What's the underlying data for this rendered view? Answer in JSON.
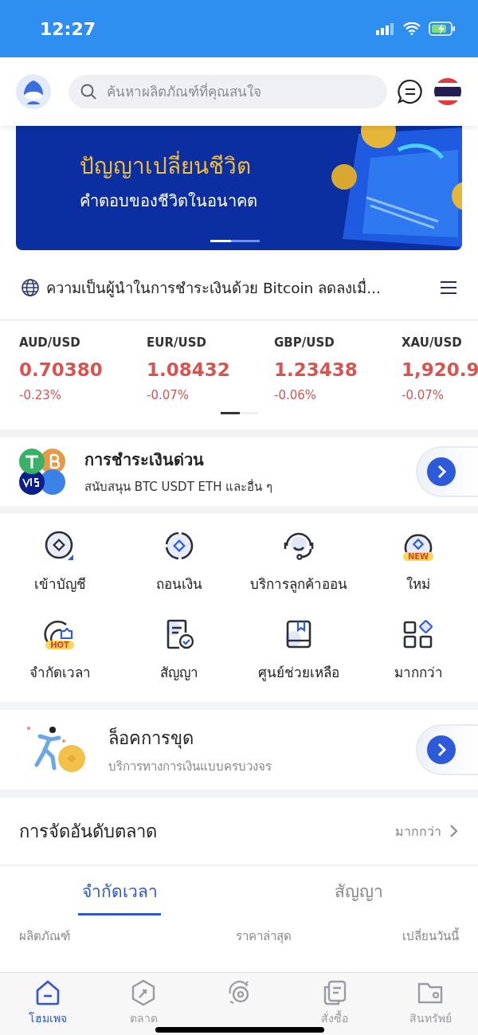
{
  "status_bar": {
    "time": "12:27"
  },
  "header": {
    "search": {
      "placeholder": "ค้นหาผลิตภัณฑ์ที่คุณสนใจ"
    }
  },
  "banner": {
    "title": "ปัญญาเปลี่ยนชีวิต",
    "subtitle": "คำตอบของชีวิตในอนาคต",
    "pages": [
      {
        "selected": true
      },
      {
        "selected": false
      }
    ]
  },
  "ticker": {
    "text": "ความเป็นผู้นำในการชำระเงินด้วย Bitcoin ลดลงเมื่..."
  },
  "quotes": [
    {
      "pair": "AUD/USD",
      "price": "0.70380",
      "change": "-0.23%"
    },
    {
      "pair": "EUR/USD",
      "price": "1.08432",
      "change": "-0.07%"
    },
    {
      "pair": "GBP/USD",
      "price": "1.23438",
      "change": "-0.06%"
    },
    {
      "pair": "XAU/USD",
      "price": "1,920.9",
      "change": "-0.07%"
    }
  ],
  "quote_pages": [
    {
      "selected": true
    },
    {
      "selected": false
    }
  ],
  "quick_pay": {
    "title": "การชำระเงินด่วน",
    "subtitle": "สนับสนุน BTC USDT ETH และอื่น ๆ"
  },
  "shortcuts": [
    {
      "kind": "deposit",
      "label": "เข้าบัญชี"
    },
    {
      "kind": "withdraw",
      "label": "ถอนเงิน"
    },
    {
      "kind": "support",
      "label": "บริการลูกค้าออน"
    },
    {
      "kind": "new",
      "label": "ใหม่",
      "badge": "NEW"
    },
    {
      "kind": "timer",
      "label": "จำกัดเวลา",
      "badge": "HOT"
    },
    {
      "kind": "contract",
      "label": "สัญญา"
    },
    {
      "kind": "help",
      "label": "ศูนย์ช่วยเหลือ"
    },
    {
      "kind": "more",
      "label": "มากกว่า"
    }
  ],
  "mining": {
    "title": "ล็อคการขุด",
    "subtitle": "บริการทางการเงินแบบครบวงจร"
  },
  "ranking": {
    "title": "การจัดอันดับตลาด",
    "more": "มากกว่า",
    "tabs": [
      {
        "label": "จำกัดเวลา",
        "selected": true
      },
      {
        "label": "สัญญา",
        "selected": false
      }
    ],
    "columns": [
      "ผลิตภัณฑ์",
      "ราคาล่าสุด",
      "เปลี่ยนวันนี้"
    ]
  },
  "bottom_nav": [
    {
      "kind": "home",
      "label": "โฮมเพจ",
      "selected": true
    },
    {
      "kind": "market",
      "label": "ตลาด",
      "selected": false
    },
    {
      "kind": "trade",
      "selected": false
    },
    {
      "kind": "orders",
      "label": "สั่งซื้อ",
      "selected": false
    },
    {
      "kind": "assets",
      "label": "สินทรัพย์",
      "selected": false
    }
  ]
}
